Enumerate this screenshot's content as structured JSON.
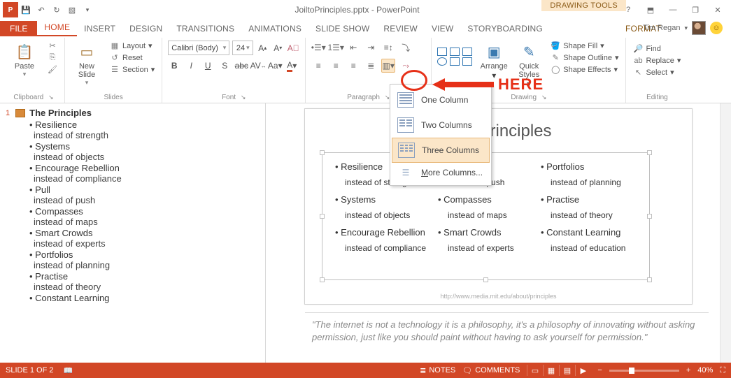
{
  "title": "JoiltoPrinciples.pptx - PowerPoint",
  "contextual_tab_group": "DRAWING TOOLS",
  "contextual_tab": "FORMAT",
  "user_name": "Tim Regan",
  "annotation": "HERE",
  "tabs": {
    "file": "FILE",
    "home": "HOME",
    "insert": "INSERT",
    "design": "DESIGN",
    "transitions": "TRANSITIONS",
    "animations": "ANIMATIONS",
    "slideshow": "SLIDE SHOW",
    "review": "REVIEW",
    "view": "VIEW",
    "storyboarding": "STORYBOARDING"
  },
  "ribbon": {
    "clipboard": {
      "paste": "Paste",
      "cut": "Cut",
      "copy": "Copy",
      "label": "Clipboard"
    },
    "slides": {
      "new": "New\nSlide",
      "layout": "Layout",
      "reset": "Reset",
      "section": "Section",
      "label": "Slides"
    },
    "font": {
      "name": "Calibri (Body)",
      "size": "24",
      "label": "Font"
    },
    "paragraph": {
      "label": "Paragraph"
    },
    "drawing": {
      "shapes": "Shapes",
      "arrange": "Arrange",
      "quick": "Quick\nStyles",
      "fill": "Shape Fill",
      "outline": "Shape Outline",
      "effects": "Shape Effects",
      "label": "Drawing"
    },
    "editing": {
      "find": "Find",
      "replace": "Replace",
      "select": "Select",
      "label": "Editing"
    }
  },
  "columns_menu": {
    "one": "One Column",
    "two": "Two Columns",
    "three": "Three Columns",
    "more": "More Columns..."
  },
  "outline": {
    "slide_num": "1",
    "title": "The Principles",
    "items": [
      {
        "t": "Resilience",
        "s": "instead of strength"
      },
      {
        "t": "Systems",
        "s": "instead of objects"
      },
      {
        "t": "Encourage Rebellion",
        "s": "instead of compliance"
      },
      {
        "t": "Pull",
        "s": "instead of push"
      },
      {
        "t": "Compasses",
        "s": "instead of maps"
      },
      {
        "t": "Smart Crowds",
        "s": "instead of experts"
      },
      {
        "t": "Portfolios",
        "s": "instead of planning"
      },
      {
        "t": "Practise",
        "s": "instead of  theory"
      },
      {
        "t": "Constant Learning",
        "s": ""
      }
    ]
  },
  "slide": {
    "title": "The Principles",
    "cells": [
      {
        "h": "• Resilience",
        "s": "instead of strength"
      },
      {
        "h": "• Pull",
        "s": "instead of push"
      },
      {
        "h": "• Portfolios",
        "s": "instead of planning"
      },
      {
        "h": "• Systems",
        "s": "instead of objects"
      },
      {
        "h": "• Compasses",
        "s": "instead of maps"
      },
      {
        "h": "• Practise",
        "s": "instead of  theory"
      },
      {
        "h": "• Encourage Rebellion",
        "s": "instead of compliance"
      },
      {
        "h": "• Smart Crowds",
        "s": "instead of experts"
      },
      {
        "h": "• Constant Learning",
        "s": "instead of education"
      }
    ],
    "url": "http://www.media.mit.edu/about/principles"
  },
  "notes": "\"The internet is not a technology it is a philosophy, it's a philosophy of innovating without asking permission, just like you should paint without having to ask yourself for permission.\"",
  "status": {
    "slide": "SLIDE 1 OF 2",
    "notes": "NOTES",
    "comments": "COMMENTS",
    "zoom": "40%"
  }
}
